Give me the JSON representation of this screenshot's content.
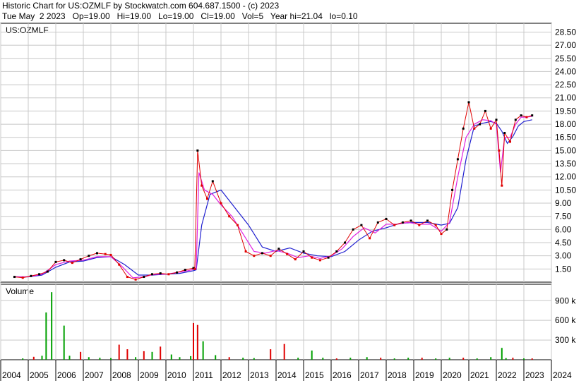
{
  "header": {
    "title_line": "Historic Chart for US:OZMLF by Stockwatch.com 604.687.1500 - (c) 2023",
    "quote_line": "Tue May  2 2023   Op=19.00   Hi=19.00   Lo=19.00   Cl=19.00   Vol=5   Year hi=21.04   lo=0.10"
  },
  "colors": {
    "price_up": "#000000",
    "price_down": "#e00000",
    "ma_short": "#e020e0",
    "ma_long": "#2020d0",
    "volume_up": "#00a000",
    "volume_down": "#e00000",
    "grid": "#c8c8c8"
  },
  "chart_data": [
    {
      "type": "line",
      "panel": "price",
      "symbol_label": "US:OZMLF",
      "y_ticks": [
        "28.50",
        "27.00",
        "25.50",
        "24.00",
        "22.50",
        "21.00",
        "19.50",
        "18.00",
        "16.50",
        "15.00",
        "13.50",
        "12.00",
        "10.50",
        "9.00",
        "7.50",
        "6.00",
        "4.50",
        "3.00",
        "1.50"
      ],
      "ylim": [
        0,
        29.5
      ],
      "x_ticks": [
        "2004",
        "2005",
        "2006",
        "2007",
        "2008",
        "2009",
        "2010",
        "2011",
        "2012",
        "2013",
        "2014",
        "2015",
        "2016",
        "2017",
        "2018",
        "2019",
        "2020",
        "2021",
        "2022",
        "2023",
        "2024"
      ],
      "xlim": [
        2004,
        2024
      ],
      "series": [
        {
          "role": "price",
          "x": [
            2004.5,
            2004.8,
            2005.1,
            2005.4,
            2005.7,
            2006.0,
            2006.3,
            2006.6,
            2006.9,
            2007.2,
            2007.5,
            2007.8,
            2008.0,
            2008.3,
            2008.6,
            2008.9,
            2009.2,
            2009.5,
            2009.8,
            2010.1,
            2010.4,
            2010.7,
            2011.0,
            2011.05,
            2011.15,
            2011.3,
            2011.5,
            2011.7,
            2012.0,
            2012.3,
            2012.6,
            2012.9,
            2013.2,
            2013.5,
            2013.8,
            2014.1,
            2014.4,
            2014.7,
            2015.0,
            2015.3,
            2015.6,
            2015.9,
            2016.2,
            2016.5,
            2016.8,
            2017.1,
            2017.4,
            2017.7,
            2018.0,
            2018.3,
            2018.6,
            2018.9,
            2019.2,
            2019.5,
            2019.8,
            2020.0,
            2020.2,
            2020.4,
            2020.6,
            2020.8,
            2021.0,
            2021.2,
            2021.4,
            2021.6,
            2021.8,
            2022.0,
            2022.1,
            2022.2,
            2022.3,
            2022.5,
            2022.7,
            2022.9,
            2023.1,
            2023.3
          ],
          "y": [
            0.6,
            0.5,
            0.7,
            0.9,
            1.2,
            2.3,
            2.5,
            2.2,
            2.6,
            3.0,
            3.3,
            3.2,
            3.1,
            2.0,
            0.6,
            0.3,
            0.6,
            0.9,
            1.0,
            0.9,
            1.1,
            1.4,
            1.6,
            1.5,
            15.0,
            11.0,
            9.5,
            11.5,
            9.0,
            7.5,
            6.5,
            3.5,
            3.0,
            3.3,
            3.0,
            3.8,
            3.2,
            2.6,
            3.5,
            2.8,
            2.5,
            2.8,
            3.5,
            4.5,
            6.0,
            6.5,
            5.0,
            6.8,
            7.2,
            6.5,
            6.8,
            7.0,
            6.5,
            7.0,
            6.5,
            5.5,
            6.0,
            10.5,
            14.0,
            17.5,
            20.5,
            17.5,
            18.0,
            19.5,
            17.5,
            18.5,
            15.0,
            11.0,
            17.0,
            16.0,
            18.5,
            19.0,
            18.8,
            19.0
          ]
        },
        {
          "role": "ma_short",
          "x": [
            2004.5,
            2005.0,
            2005.5,
            2006.0,
            2006.5,
            2007.0,
            2007.5,
            2008.0,
            2008.4,
            2008.8,
            2009.2,
            2009.6,
            2010.0,
            2010.4,
            2010.8,
            2011.1,
            2011.2,
            2011.4,
            2011.7,
            2012.0,
            2012.4,
            2012.8,
            2013.2,
            2013.6,
            2014.0,
            2014.4,
            2014.8,
            2015.2,
            2015.6,
            2016.0,
            2016.4,
            2016.8,
            2017.2,
            2017.6,
            2018.0,
            2018.4,
            2018.8,
            2019.2,
            2019.6,
            2020.0,
            2020.3,
            2020.6,
            2020.9,
            2021.2,
            2021.5,
            2021.8,
            2022.0,
            2022.15,
            2022.3,
            2022.5,
            2022.7,
            2022.9,
            2023.1,
            2023.3
          ],
          "y": [
            0.6,
            0.6,
            0.9,
            2.0,
            2.4,
            2.5,
            2.9,
            2.9,
            1.8,
            0.5,
            0.6,
            0.9,
            0.9,
            1.1,
            1.3,
            1.5,
            12.5,
            10.5,
            10.0,
            8.8,
            7.5,
            5.5,
            3.5,
            3.3,
            3.6,
            3.3,
            2.8,
            3.0,
            2.7,
            3.0,
            3.8,
            5.2,
            6.2,
            5.6,
            6.6,
            6.6,
            6.8,
            6.6,
            6.6,
            5.8,
            6.8,
            12.0,
            16.5,
            18.0,
            18.5,
            18.4,
            18.0,
            12.5,
            16.5,
            16.5,
            18.0,
            18.8,
            18.8,
            18.9
          ]
        },
        {
          "role": "ma_long",
          "x": [
            2004.5,
            2005.0,
            2005.5,
            2006.0,
            2006.5,
            2007.0,
            2007.5,
            2008.0,
            2008.5,
            2009.0,
            2009.5,
            2010.0,
            2010.5,
            2011.0,
            2011.1,
            2011.3,
            2011.6,
            2012.0,
            2012.5,
            2013.0,
            2013.5,
            2014.0,
            2014.5,
            2015.0,
            2015.5,
            2016.0,
            2016.5,
            2017.0,
            2017.5,
            2018.0,
            2018.5,
            2019.0,
            2019.5,
            2020.0,
            2020.3,
            2020.6,
            2020.9,
            2021.2,
            2021.5,
            2021.8,
            2022.0,
            2022.2,
            2022.4,
            2022.6,
            2022.8,
            2023.0,
            2023.3
          ],
          "y": [
            0.6,
            0.6,
            0.8,
            1.7,
            2.3,
            2.4,
            2.8,
            2.9,
            2.0,
            0.8,
            0.8,
            0.9,
            1.0,
            1.3,
            1.4,
            6.5,
            10.0,
            10.5,
            8.5,
            6.5,
            4.0,
            3.5,
            3.9,
            3.3,
            3.0,
            2.9,
            3.5,
            4.8,
            5.8,
            6.2,
            6.7,
            6.8,
            6.8,
            6.5,
            6.7,
            8.5,
            14.0,
            17.8,
            18.1,
            18.3,
            18.1,
            17.2,
            15.8,
            16.6,
            17.8,
            18.3,
            18.5
          ]
        }
      ]
    },
    {
      "type": "bar",
      "panel": "volume",
      "title": "Volume",
      "y_ticks": [
        "900 k",
        "600 k",
        "300 k"
      ],
      "ylim": [
        0,
        1150000
      ],
      "x": [
        2004.8,
        2005.2,
        2005.5,
        2005.65,
        2005.85,
        2006.3,
        2006.5,
        2006.9,
        2007.2,
        2007.6,
        2008.0,
        2008.3,
        2008.6,
        2008.9,
        2009.2,
        2009.5,
        2009.8,
        2010.2,
        2010.5,
        2010.9,
        2011.0,
        2011.15,
        2011.35,
        2011.8,
        2012.3,
        2012.8,
        2013.2,
        2013.8,
        2014.3,
        2014.8,
        2015.3,
        2015.7,
        2016.2,
        2016.7,
        2017.3,
        2017.8,
        2018.3,
        2018.8,
        2019.3,
        2019.8,
        2020.3,
        2020.8,
        2021.3,
        2021.8,
        2022.2,
        2022.35,
        2022.6,
        2023.0,
        2023.3
      ],
      "values": [
        20000,
        45000,
        60000,
        720000,
        1030000,
        520000,
        60000,
        120000,
        40000,
        30000,
        25000,
        230000,
        160000,
        40000,
        130000,
        120000,
        200000,
        80000,
        40000,
        55000,
        560000,
        530000,
        280000,
        70000,
        40000,
        30000,
        25000,
        160000,
        240000,
        30000,
        140000,
        30000,
        20000,
        30000,
        40000,
        30000,
        20000,
        30000,
        30000,
        20000,
        30000,
        30000,
        20000,
        40000,
        180000,
        25000,
        30000,
        20000,
        20000
      ],
      "direction": [
        "up",
        "down",
        "up",
        "up",
        "up",
        "up",
        "up",
        "down",
        "up",
        "up",
        "up",
        "down",
        "down",
        "up",
        "down",
        "up",
        "down",
        "up",
        "up",
        "up",
        "down",
        "down",
        "up",
        "up",
        "down",
        "up",
        "up",
        "down",
        "down",
        "up",
        "up",
        "up",
        "down",
        "up",
        "up",
        "down",
        "up",
        "up",
        "down",
        "up",
        "up",
        "down",
        "up",
        "up",
        "up",
        "up",
        "down",
        "up",
        "down"
      ]
    }
  ]
}
